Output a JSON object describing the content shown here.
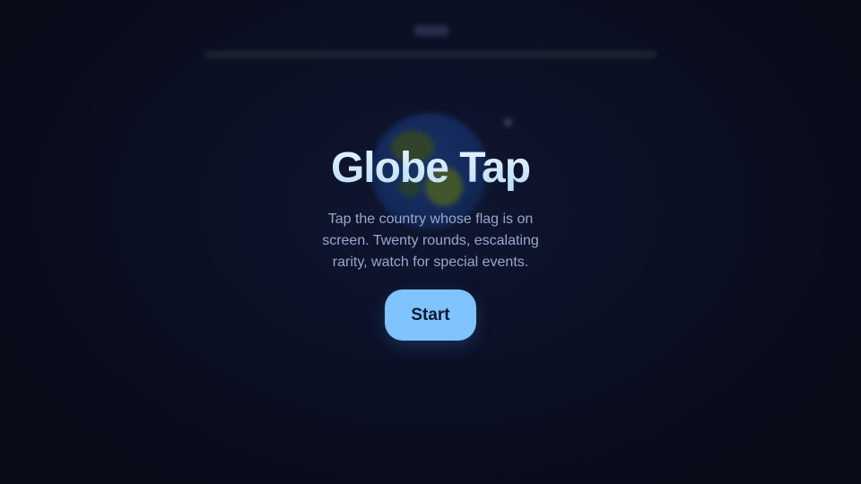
{
  "game": {
    "title": "Globe Tap",
    "description": "Tap the country whose flag is on screen. Twenty rounds, escalating rarity, watch for special events.",
    "start_label": "Start"
  },
  "background_scene": {
    "globe_icon": "globe-icon"
  },
  "colors": {
    "background": "#0a0e1d",
    "title": "#d4e8ff",
    "description": "#9aa6cc",
    "start_button": "#7fc3ff",
    "start_button_text": "#0d1a2e"
  }
}
